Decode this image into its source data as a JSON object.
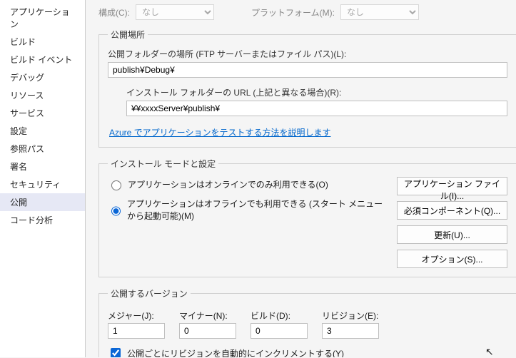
{
  "sidebar": {
    "items": [
      {
        "label": "アプリケーション"
      },
      {
        "label": "ビルド"
      },
      {
        "label": "ビルド イベント"
      },
      {
        "label": "デバッグ"
      },
      {
        "label": "リソース"
      },
      {
        "label": "サービス"
      },
      {
        "label": "設定"
      },
      {
        "label": "参照パス"
      },
      {
        "label": "署名"
      },
      {
        "label": "セキュリティ"
      },
      {
        "label": "公開"
      },
      {
        "label": "コード分析"
      }
    ],
    "selected_index": 10
  },
  "top": {
    "config_label": "構成(C):",
    "config_value": "なし",
    "platform_label": "プラットフォーム(M):",
    "platform_value": "なし"
  },
  "publish_location": {
    "legend": "公開場所",
    "folder_label": "公開フォルダーの場所 (FTP サーバーまたはファイル パス)(L):",
    "folder_value": "publish¥Debug¥",
    "install_url_label": "インストール フォルダーの URL (上記と異なる場合)(R):",
    "install_url_value": "¥¥xxxxServer¥publish¥",
    "azure_link": "Azure でアプリケーションをテストする方法を説明します"
  },
  "install_mode": {
    "legend": "インストール モードと設定",
    "online_label": "アプリケーションはオンラインでのみ利用できる(O)",
    "offline_label": "アプリケーションはオフラインでも利用できる (スタート メニューから起動可能)(M)",
    "selected": "offline",
    "buttons": {
      "app_files": "アプリケーション ファイル(I)...",
      "prereq": "必須コンポーネント(Q)...",
      "updates": "更新(U)...",
      "options": "オプション(S)..."
    }
  },
  "version": {
    "legend": "公開するバージョン",
    "major_label": "メジャー(J):",
    "major_value": "1",
    "minor_label": "マイナー(N):",
    "minor_value": "0",
    "build_label": "ビルド(D):",
    "build_value": "0",
    "revision_label": "リビジョン(E):",
    "revision_value": "3",
    "auto_increment_label": "公開ごとにリビジョンを自動的にインクリメントする(Y)",
    "auto_increment_checked": true
  }
}
